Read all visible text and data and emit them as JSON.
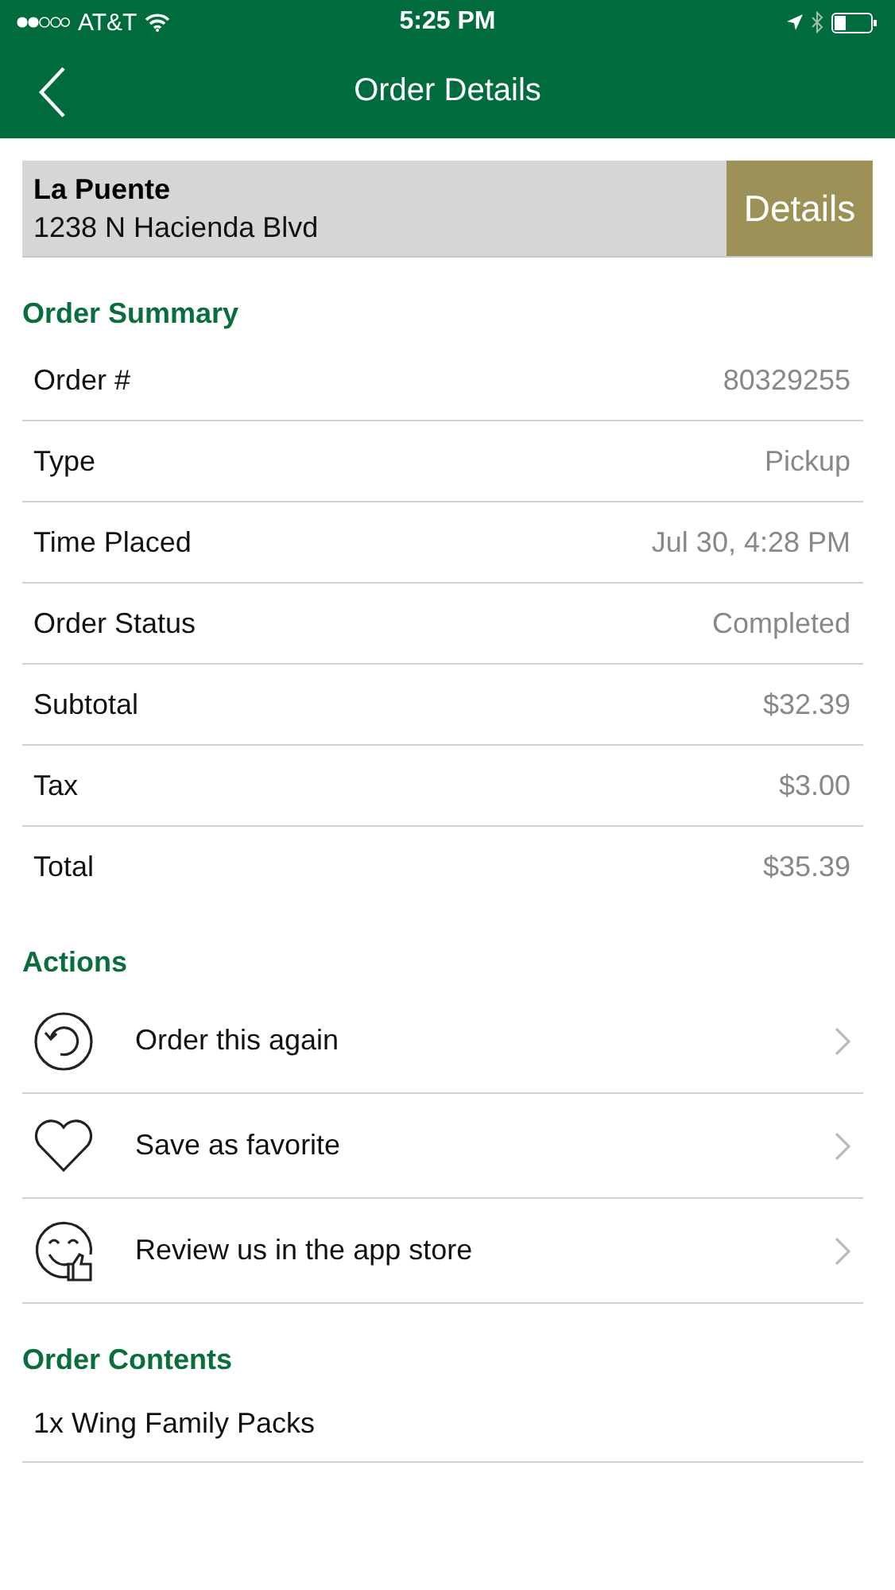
{
  "status_bar": {
    "carrier": "AT&T",
    "time": "5:25 PM"
  },
  "nav": {
    "title": "Order Details"
  },
  "store": {
    "name": "La Puente",
    "address": "1238 N Hacienda Blvd",
    "button": "Details"
  },
  "order_summary": {
    "heading": "Order Summary",
    "rows": [
      {
        "label": "Order #",
        "value": "80329255"
      },
      {
        "label": "Type",
        "value": "Pickup"
      },
      {
        "label": "Time Placed",
        "value": "Jul 30, 4:28 PM"
      },
      {
        "label": "Order Status",
        "value": "Completed"
      },
      {
        "label": "Subtotal",
        "value": "$32.39"
      },
      {
        "label": "Tax",
        "value": "$3.00"
      },
      {
        "label": "Total",
        "value": "$35.39"
      }
    ]
  },
  "actions": {
    "heading": "Actions",
    "items": [
      {
        "label": "Order this again"
      },
      {
        "label": "Save as favorite"
      },
      {
        "label": "Review us in the app store"
      }
    ]
  },
  "order_contents": {
    "heading": "Order Contents",
    "items": [
      "1x Wing Family Packs"
    ]
  }
}
